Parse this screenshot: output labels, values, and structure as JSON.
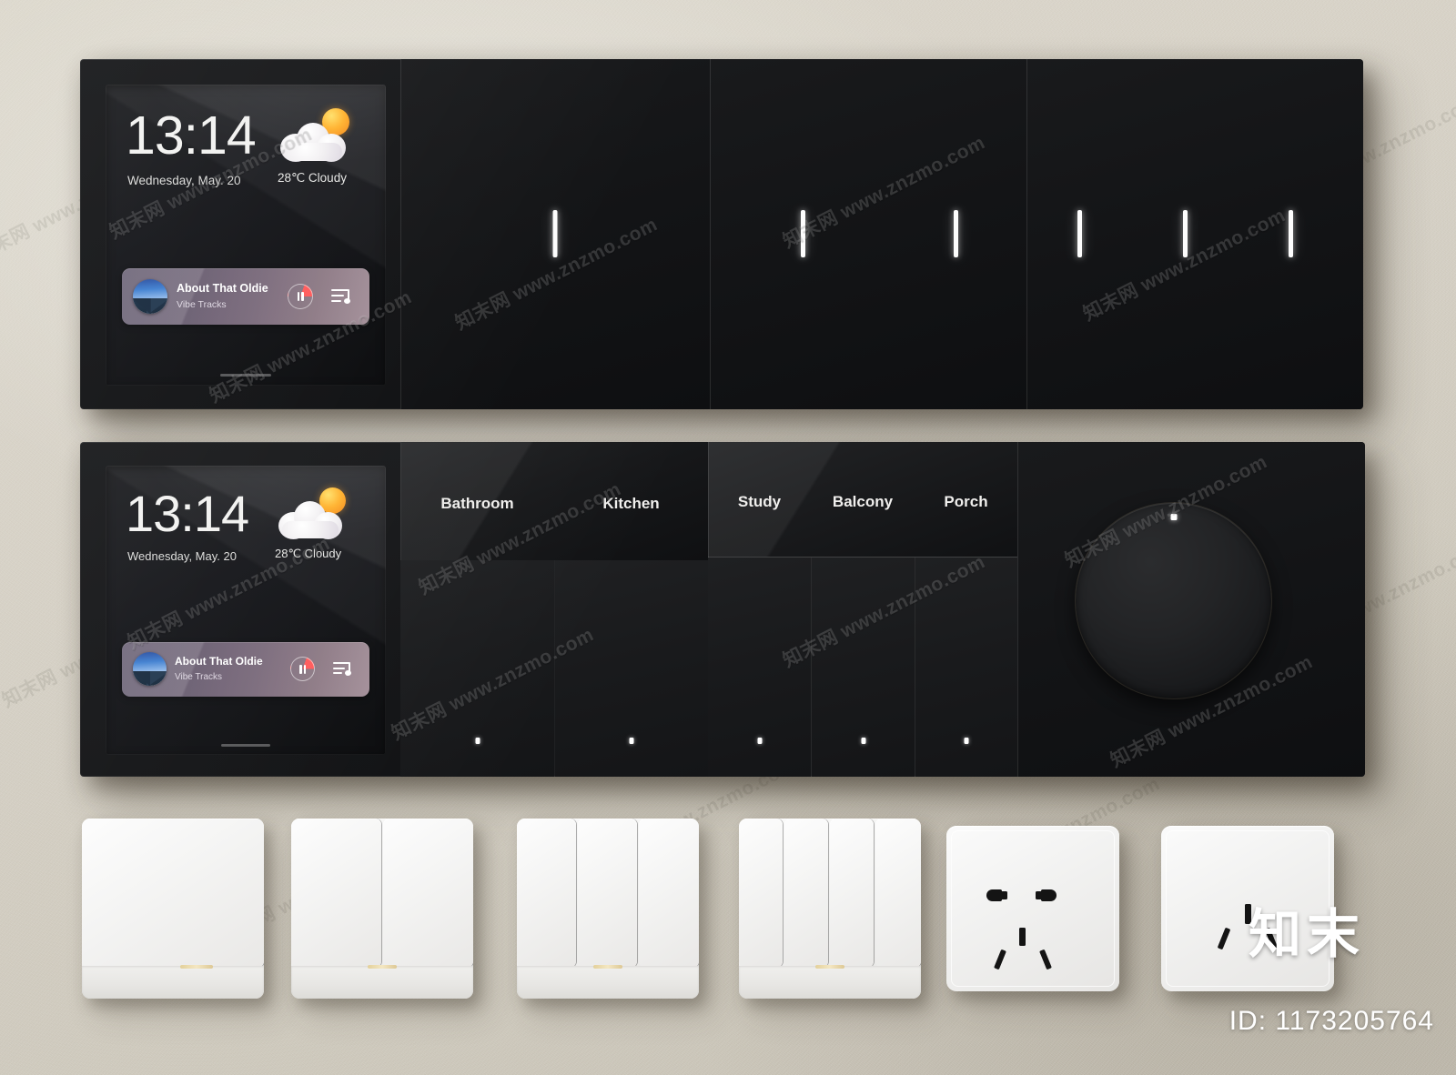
{
  "scene": {
    "wall_color": "#d6d2c9",
    "panel_color": "#131416",
    "accent_led_color": "#ffffff",
    "device_white": "#f4f3f1"
  },
  "watermark": {
    "site_text": "知末网 www.znzmo.com",
    "brand_text": "知末",
    "id_label": "ID: 1173205764"
  },
  "panel_top": {
    "name": "Smart Panel Row 1",
    "screen": {
      "time": "13:14",
      "date": "Wednesday, May. 20",
      "weather_temp": "28℃",
      "weather_condition": "Cloudy",
      "weather_text": "28℃  Cloudy",
      "weather_icon": "sun-behind-cloud-icon",
      "music": {
        "title": "About That Oldie",
        "artist": "Vibe Tracks",
        "play_state": "pause-icon",
        "playlist_icon": "playlist-icon",
        "album_art": "mountain-sky-artwork"
      }
    },
    "switch_modules": [
      {
        "name": "one-gang-module",
        "gangs": 1
      },
      {
        "name": "two-gang-module",
        "gangs": 2
      },
      {
        "name": "three-gang-module",
        "gangs": 3
      }
    ]
  },
  "panel_bottom": {
    "name": "Smart Panel Row 2",
    "screen": {
      "time": "13:14",
      "date": "Wednesday, May. 20",
      "weather_temp": "28℃",
      "weather_condition": "Cloudy",
      "weather_text": "28℃  Cloudy",
      "weather_icon": "sun-behind-cloud-icon",
      "music": {
        "title": "About That Oldie",
        "artist": "Vibe Tracks",
        "play_state": "pause-icon",
        "playlist_icon": "playlist-icon",
        "album_art": "mountain-sky-artwork"
      }
    },
    "room_group_a": {
      "labels": [
        "Bathroom",
        "Kitchen"
      ]
    },
    "room_group_b": {
      "labels": [
        "Study",
        "Balcony",
        "Porch"
      ]
    },
    "sub_buttons_count": 5,
    "knob": {
      "name": "rotary-dimmer-knob",
      "indicator": "knob-position-dot"
    }
  },
  "bottom_row_devices": [
    {
      "name": "one-gang-switch",
      "type": "switch",
      "gangs": 1
    },
    {
      "name": "two-gang-switch",
      "type": "switch",
      "gangs": 2
    },
    {
      "name": "three-gang-switch",
      "type": "switch",
      "gangs": 3
    },
    {
      "name": "four-gang-switch",
      "type": "switch",
      "gangs": 4
    },
    {
      "name": "five-hole-socket",
      "type": "socket",
      "holes": 5
    },
    {
      "name": "three-hole-socket",
      "type": "socket",
      "holes": 3
    }
  ]
}
